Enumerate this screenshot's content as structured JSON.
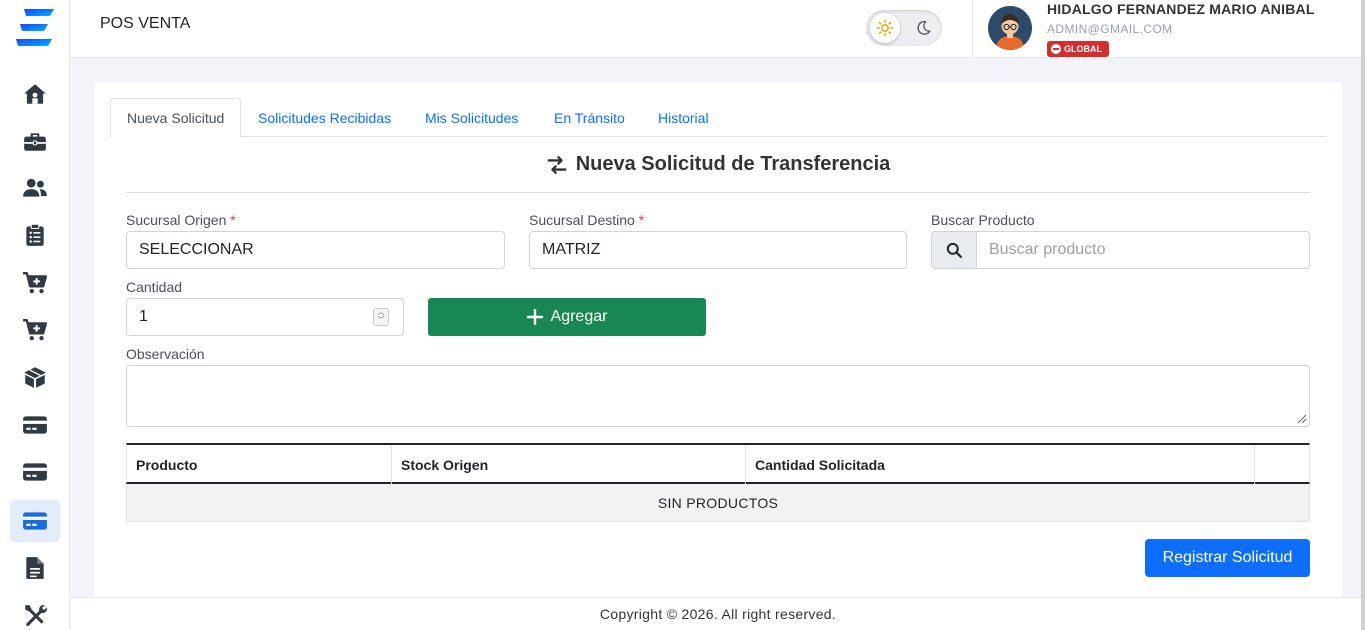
{
  "header": {
    "app_title": "POS VENTA",
    "user_name": "HIDALGO FERNANDEZ MARIO ANIBAL",
    "user_email": "ADMIN@GMAIL.COM",
    "badge": "GLOBAL"
  },
  "sidebar": {
    "items": [
      {
        "icon": "home-icon"
      },
      {
        "icon": "briefcase-icon"
      },
      {
        "icon": "users-icon"
      },
      {
        "icon": "clipboard-list-icon"
      },
      {
        "icon": "cart-plus-icon"
      },
      {
        "icon": "cart-plus-icon"
      },
      {
        "icon": "box-open-icon"
      },
      {
        "icon": "credit-card-icon"
      },
      {
        "icon": "credit-card-icon"
      },
      {
        "icon": "credit-card-icon",
        "active": true
      },
      {
        "icon": "file-text-icon"
      },
      {
        "icon": "tools-icon"
      }
    ]
  },
  "tabs": [
    {
      "label": "Nueva Solicitud",
      "active": true
    },
    {
      "label": "Solicitudes Recibidas"
    },
    {
      "label": "Mis Solicitudes"
    },
    {
      "label": "En Tránsito"
    },
    {
      "label": "Historial"
    }
  ],
  "form": {
    "title": "Nueva Solicitud de Transferencia",
    "origen_label": "Sucursal Origen",
    "origen_value": "SELECCIONAR",
    "destino_label": "Sucursal Destino",
    "destino_value": "MATRIZ",
    "required_mark": "*",
    "buscar_label": "Buscar Producto",
    "buscar_placeholder": "Buscar producto",
    "cantidad_label": "Cantidad",
    "cantidad_value": "1",
    "agregar_label": "Agregar",
    "observacion_label": "Observación",
    "registrar_label": "Registrar Solicitud"
  },
  "table": {
    "columns": [
      "Producto",
      "Stock Origen",
      "Cantidad Solicitada",
      ""
    ],
    "empty_text": "SIN PRODUCTOS"
  },
  "footer": {
    "copyright": "Copyright © 2026. All right reserved."
  },
  "colors": {
    "primary": "#0d6efd",
    "success": "#198754",
    "badge": "#d32f2f",
    "icon": "#2f3a45",
    "active_icon": "#1a6dd8"
  }
}
